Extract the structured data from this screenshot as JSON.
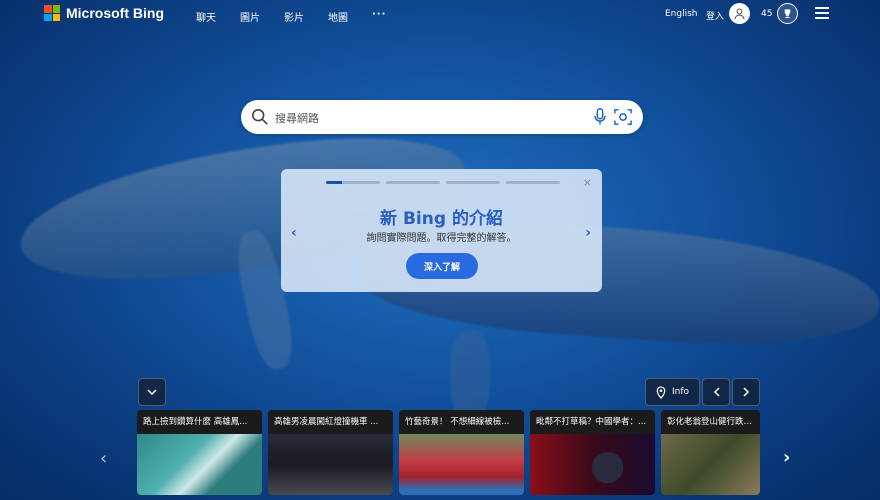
{
  "header": {
    "logo_text": "Microsoft Bing",
    "nav": [
      "聊天",
      "圖片",
      "影片",
      "地圖"
    ],
    "more": "···",
    "language": "English",
    "login": "登入",
    "points": "45"
  },
  "search": {
    "placeholder": "搜尋網路"
  },
  "promo": {
    "title": "新 Bing 的介紹",
    "subtitle": "詢問實際問題。取得完整的解答。",
    "button": "深入了解",
    "close": "×",
    "prev": "‹",
    "next": "›"
  },
  "controls": {
    "info": "Info"
  },
  "news": [
    {
      "title": "路上撿到鑽算什麼 高雄鳳..."
    },
    {
      "title": "高雄男凌晨闖紅燈撞機車 ..."
    },
    {
      "title": "竹藝奇景！ 不想細線被檢..."
    },
    {
      "title": "毗鄰不打草稿？中國學者：..."
    },
    {
      "title": "彰化老翁登山健行跌落山"
    }
  ],
  "colors": {
    "accent": "#2a6ae0",
    "promo_title": "#2a5fc0",
    "background": "#11509c"
  }
}
